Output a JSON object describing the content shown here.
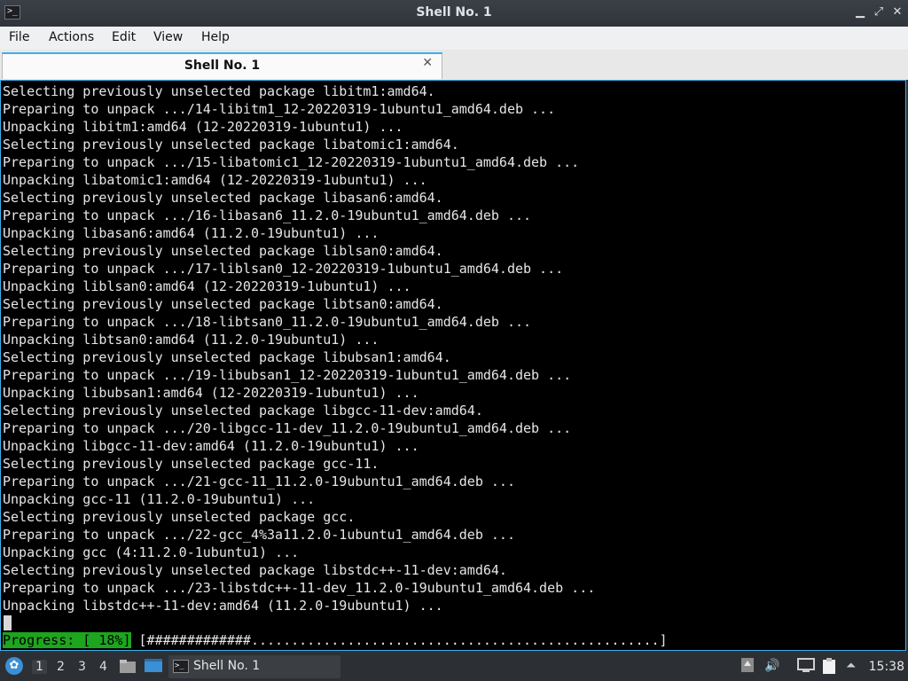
{
  "window": {
    "title": "Shell No. 1",
    "app_icon_glyph": ">_",
    "controls": {
      "minimize": "▁",
      "maximize": "⤢",
      "close": "✕"
    }
  },
  "menubar": {
    "items": [
      "File",
      "Actions",
      "Edit",
      "View",
      "Help"
    ]
  },
  "tabs": [
    {
      "label": "Shell No. 1",
      "close_glyph": "✕",
      "active": true
    }
  ],
  "terminal": {
    "lines": [
      "Selecting previously unselected package libitm1:amd64.",
      "Preparing to unpack .../14-libitm1_12-20220319-1ubuntu1_amd64.deb ...",
      "Unpacking libitm1:amd64 (12-20220319-1ubuntu1) ...",
      "Selecting previously unselected package libatomic1:amd64.",
      "Preparing to unpack .../15-libatomic1_12-20220319-1ubuntu1_amd64.deb ...",
      "Unpacking libatomic1:amd64 (12-20220319-1ubuntu1) ...",
      "Selecting previously unselected package libasan6:amd64.",
      "Preparing to unpack .../16-libasan6_11.2.0-19ubuntu1_amd64.deb ...",
      "Unpacking libasan6:amd64 (11.2.0-19ubuntu1) ...",
      "Selecting previously unselected package liblsan0:amd64.",
      "Preparing to unpack .../17-liblsan0_12-20220319-1ubuntu1_amd64.deb ...",
      "Unpacking liblsan0:amd64 (12-20220319-1ubuntu1) ...",
      "Selecting previously unselected package libtsan0:amd64.",
      "Preparing to unpack .../18-libtsan0_11.2.0-19ubuntu1_amd64.deb ...",
      "Unpacking libtsan0:amd64 (11.2.0-19ubuntu1) ...",
      "Selecting previously unselected package libubsan1:amd64.",
      "Preparing to unpack .../19-libubsan1_12-20220319-1ubuntu1_amd64.deb ...",
      "Unpacking libubsan1:amd64 (12-20220319-1ubuntu1) ...",
      "Selecting previously unselected package libgcc-11-dev:amd64.",
      "Preparing to unpack .../20-libgcc-11-dev_11.2.0-19ubuntu1_amd64.deb ...",
      "Unpacking libgcc-11-dev:amd64 (11.2.0-19ubuntu1) ...",
      "Selecting previously unselected package gcc-11.",
      "Preparing to unpack .../21-gcc-11_11.2.0-19ubuntu1_amd64.deb ...",
      "Unpacking gcc-11 (11.2.0-19ubuntu1) ...",
      "Selecting previously unselected package gcc.",
      "Preparing to unpack .../22-gcc_4%3a11.2.0-1ubuntu1_amd64.deb ...",
      "Unpacking gcc (4:11.2.0-1ubuntu1) ...",
      "Selecting previously unselected package libstdc++-11-dev:amd64.",
      "Preparing to unpack .../23-libstdc++-11-dev_11.2.0-19ubuntu1_amd64.deb ...",
      "Unpacking libstdc++-11-dev:amd64 (11.2.0-19ubuntu1) ..."
    ],
    "progress": {
      "label": "Progress: [ 18%]",
      "bar": " [#############...................................................]",
      "percent": 18
    }
  },
  "taskbar": {
    "start_glyph": "✿",
    "workspaces": [
      "1",
      "2",
      "3",
      "4"
    ],
    "active_workspace": "1",
    "task": {
      "label": "Shell No. 1",
      "icon_glyph": ">_"
    },
    "tray": {
      "volume_glyph": "🔊",
      "upload_glyph": "⏶"
    },
    "clock": "15:38"
  },
  "colors": {
    "accent": "#3daee9",
    "progress_green": "#1ea51e",
    "terminal_bg": "#000000",
    "terminal_fg": "#e6e6e6",
    "titlebar_bg": "#33373d"
  }
}
